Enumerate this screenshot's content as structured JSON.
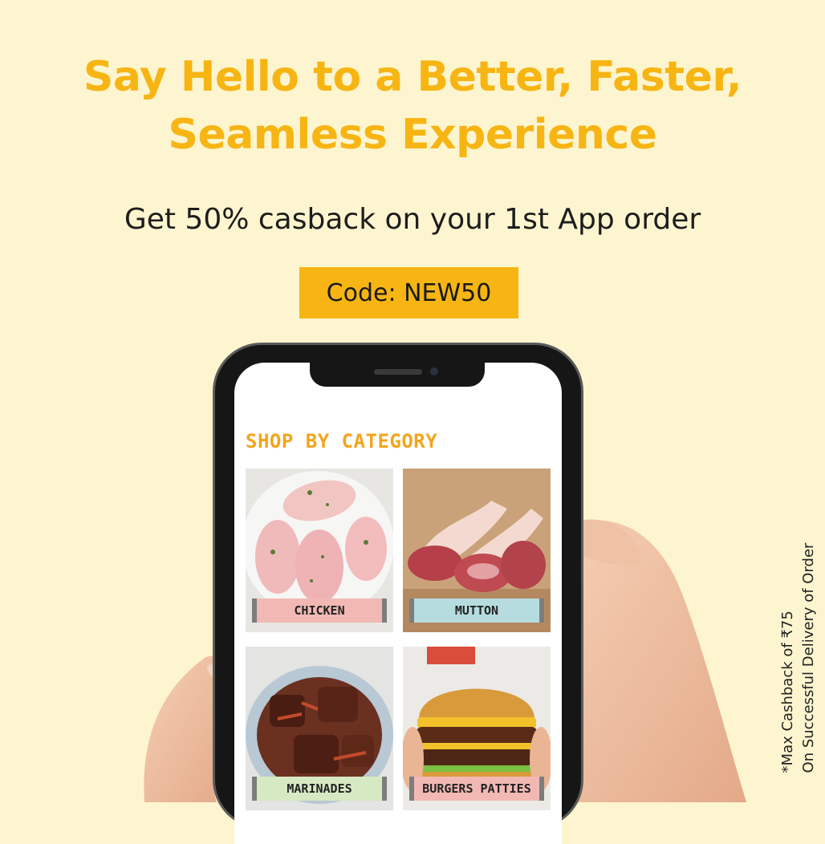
{
  "headline": {
    "line1": "Say Hello to a Better, Faster,",
    "line2": "Seamless Experience"
  },
  "offer": {
    "text": "Get 50% casback on your 1st App order",
    "code": "Code: NEW50"
  },
  "disclaimer": {
    "line1": "*Max Cashback of ₹75",
    "line2": "On Successful Delivery of Order"
  },
  "app": {
    "section_title": "SHOP BY CATEGORY",
    "categories": [
      {
        "label": "CHICKEN",
        "label_color": "#f2b9b4"
      },
      {
        "label": "MUTTON",
        "label_color": "#b7dcdf"
      },
      {
        "label": "MARINADES",
        "label_color": "#d7e9c2"
      },
      {
        "label": "BURGERS PATTIES",
        "label_color": "#f2b9b4"
      }
    ]
  },
  "colors": {
    "background": "#fdf5cf",
    "accent": "#f7b514",
    "section_title": "#f3a51b"
  }
}
